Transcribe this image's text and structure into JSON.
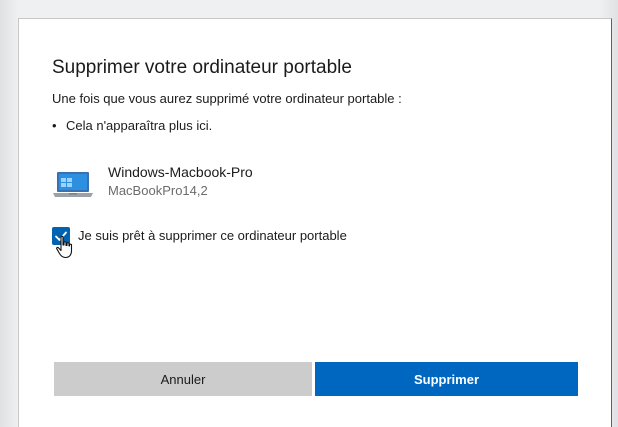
{
  "dialog": {
    "title": "Supprimer votre ordinateur portable",
    "intro": "Une fois que vous aurez supprimé votre ordinateur portable :",
    "bullets": [
      "Cela n'apparaîtra plus ici."
    ],
    "device": {
      "name": "Windows-Macbook-Pro",
      "model": "MacBookPro14,2",
      "icon": "laptop-icon"
    },
    "confirm": {
      "label": "Je suis prêt à supprimer ce ordinateur portable",
      "checked": true
    },
    "buttons": {
      "cancel_label": "Annuler",
      "delete_label": "Supprimer"
    }
  },
  "colors": {
    "accent": "#0067c0",
    "checkbox": "#0063b1",
    "cancel_bg": "#cccccc",
    "text": "#1b1b1b",
    "secondary_text": "#6b6b6b"
  }
}
